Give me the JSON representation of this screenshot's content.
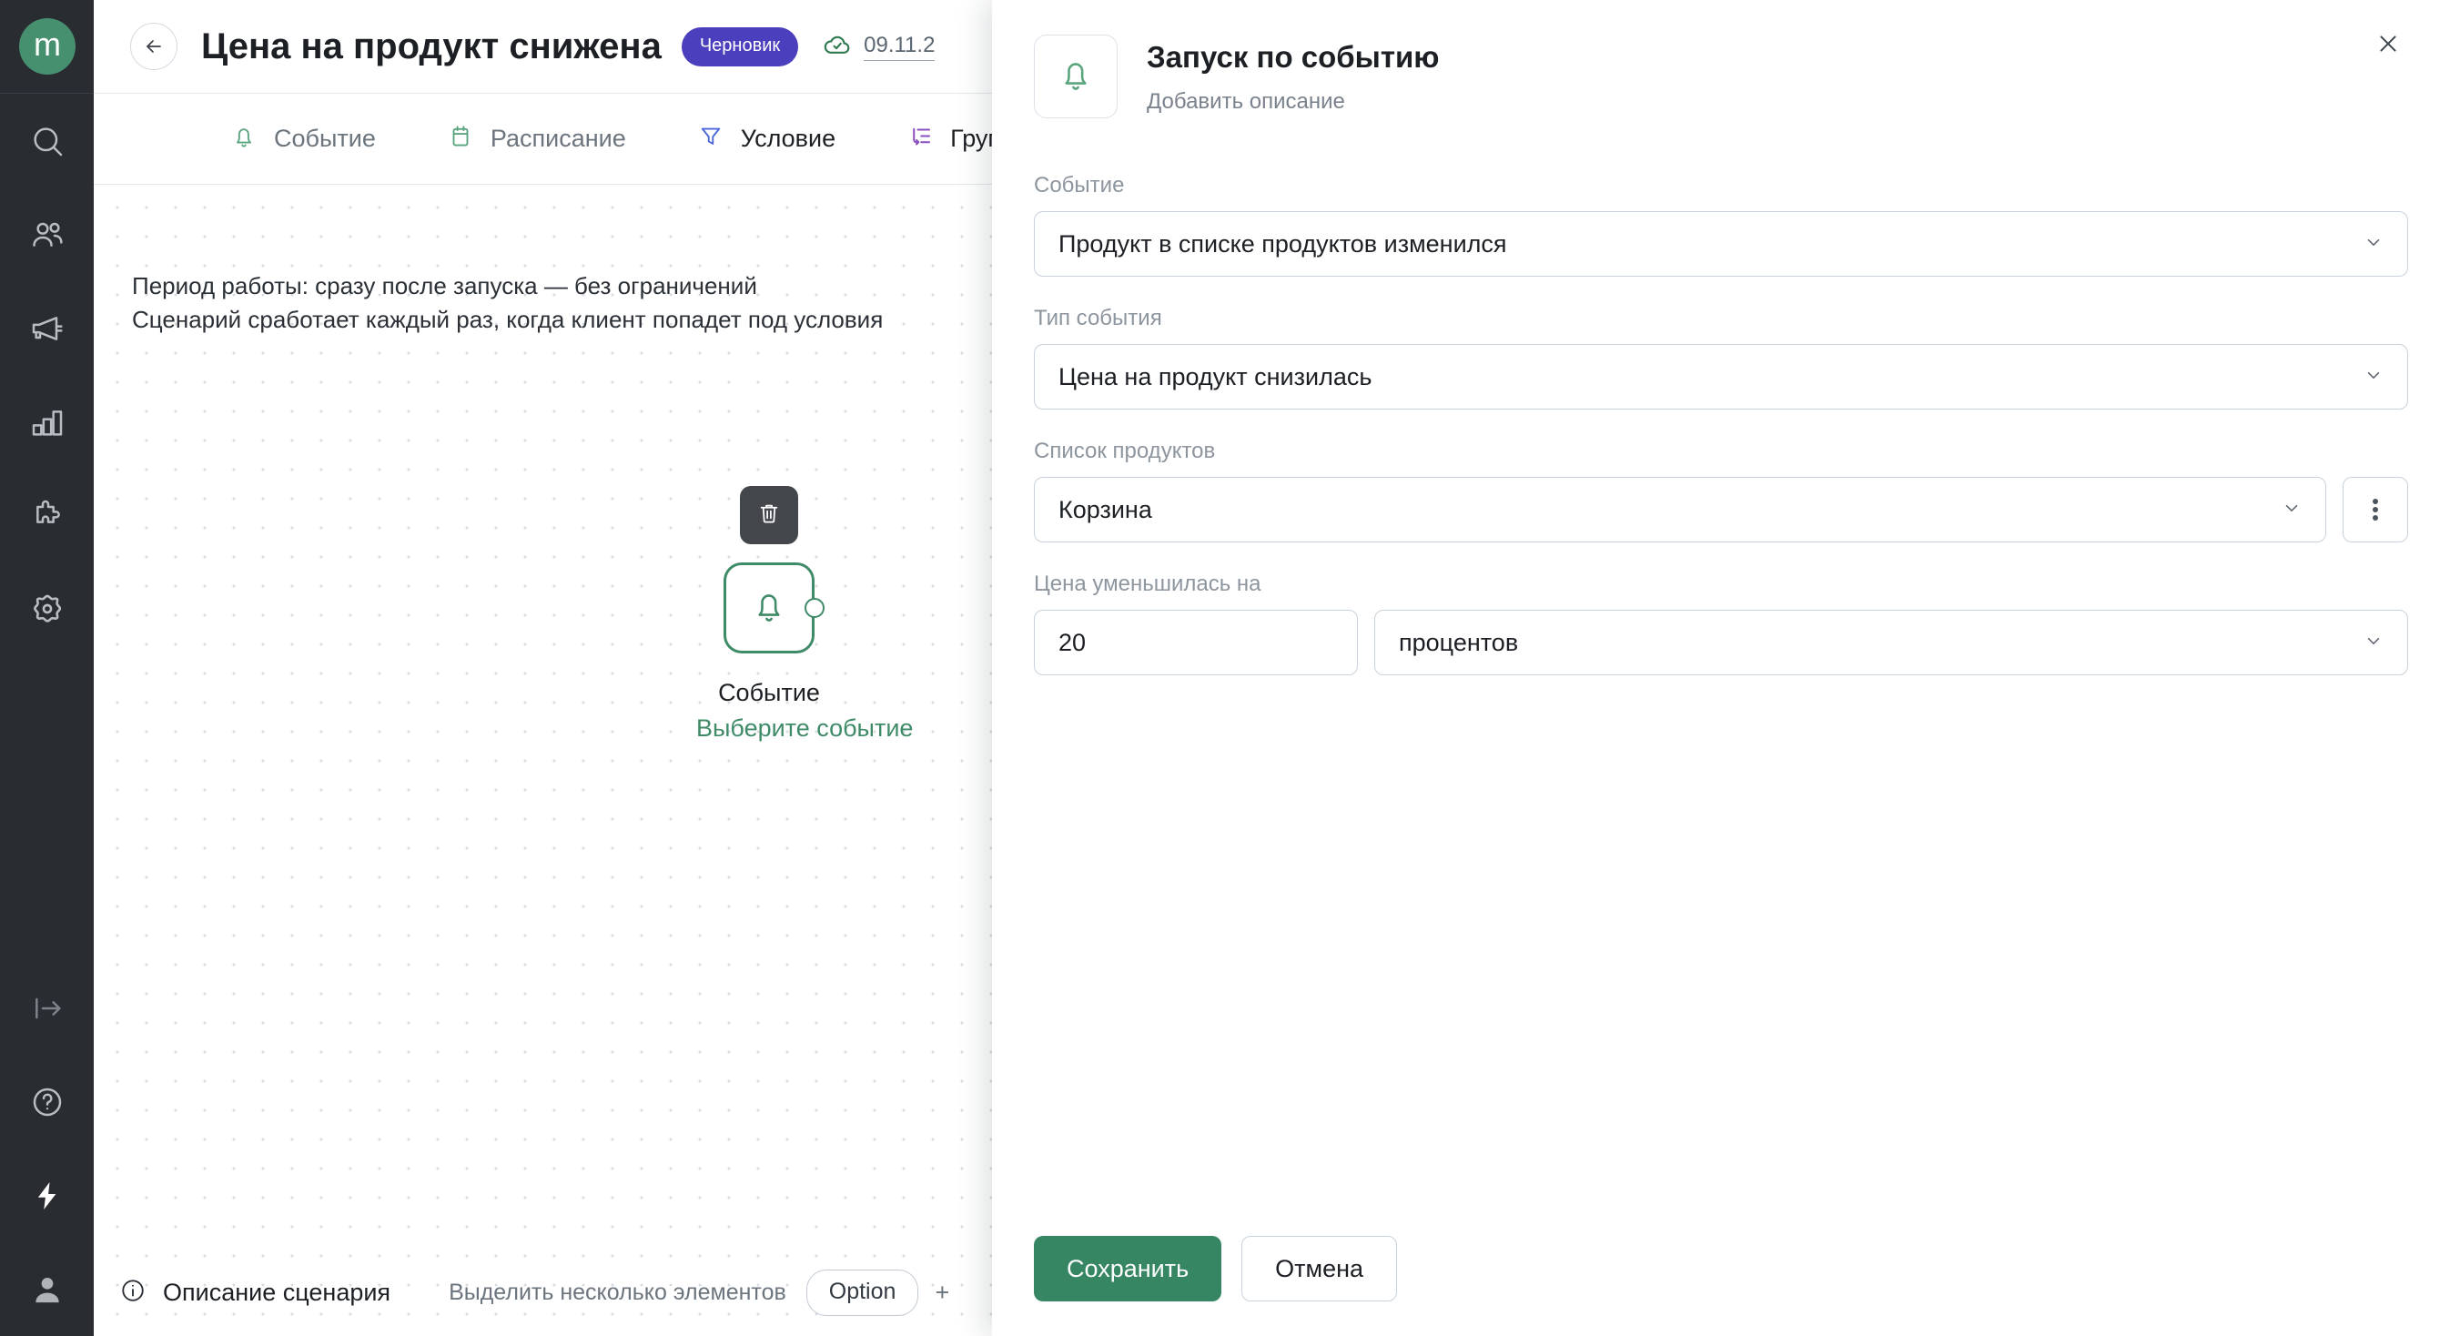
{
  "app": {
    "logo_text": "m"
  },
  "sidebar": {
    "items": [
      {
        "name": "search-icon",
        "label": "Поиск"
      },
      {
        "name": "users-icon",
        "label": "Клиенты"
      },
      {
        "name": "megaphone-icon",
        "label": "Кампании"
      },
      {
        "name": "bar-chart-icon",
        "label": "Аналитика"
      },
      {
        "name": "puzzle-icon",
        "label": "Интеграции"
      },
      {
        "name": "settings-gear-icon",
        "label": "Настройки"
      }
    ],
    "bottom_items": [
      {
        "name": "logout-icon",
        "label": "Выход"
      },
      {
        "name": "help-circle-icon",
        "label": "Помощь"
      },
      {
        "name": "lightning-icon",
        "label": "Быстрые действия"
      },
      {
        "name": "user-avatar-icon",
        "label": "Профиль"
      }
    ]
  },
  "header": {
    "back_label": "←",
    "title": "Цена на продукт снижена",
    "status_badge": "Черновик",
    "saved_icon": "cloud-check-icon",
    "saved_date": "09.11.2"
  },
  "tabs": [
    {
      "label": "Событие",
      "icon": "bell-icon",
      "color": "#4f9f78",
      "active": false
    },
    {
      "label": "Расписание",
      "icon": "calendar-icon",
      "color": "#4f9f78",
      "active": false
    },
    {
      "label": "Условие",
      "icon": "filter-icon",
      "color": "#4a66d8",
      "active": true
    },
    {
      "label": "Группа",
      "icon": "group-split-icon",
      "color": "#8b4dbd",
      "active": true
    }
  ],
  "canvas": {
    "notes": [
      "Период работы: сразу после запуска — без ограничений",
      "Сценарий сработает каждый раз, когда клиент попадет под условия"
    ],
    "node": {
      "delete_icon": "trash-icon",
      "icon": "bell-icon",
      "title": "Событие",
      "subtitle": "Выберите событие"
    }
  },
  "statusbar": {
    "info_icon": "info-circle-icon",
    "description_label": "Описание сценария",
    "hint": "Выделить несколько элементов",
    "key": "Option",
    "plus": "+"
  },
  "panel": {
    "icon": "bell-icon",
    "title": "Запуск по событию",
    "subtitle": "Добавить описание",
    "close_icon": "close-icon",
    "fields": {
      "event": {
        "label": "Событие",
        "value": "Продукт в списке продуктов изменился"
      },
      "event_type": {
        "label": "Тип события",
        "value": "Цена на продукт снизилась"
      },
      "product_list": {
        "label": "Список продуктов",
        "value": "Корзина",
        "menu_icon": "more-vertical-icon"
      },
      "price_drop": {
        "label": "Цена уменьшилась на",
        "amount": "20",
        "unit": "процентов"
      }
    },
    "footer": {
      "save": "Сохранить",
      "cancel": "Отмена"
    }
  },
  "colors": {
    "brand_green": "#469070",
    "accent_green": "#3f8b68",
    "badge_purple": "#4c3fbd",
    "sidebar_bg": "#292c31",
    "border": "#c9d2da"
  }
}
